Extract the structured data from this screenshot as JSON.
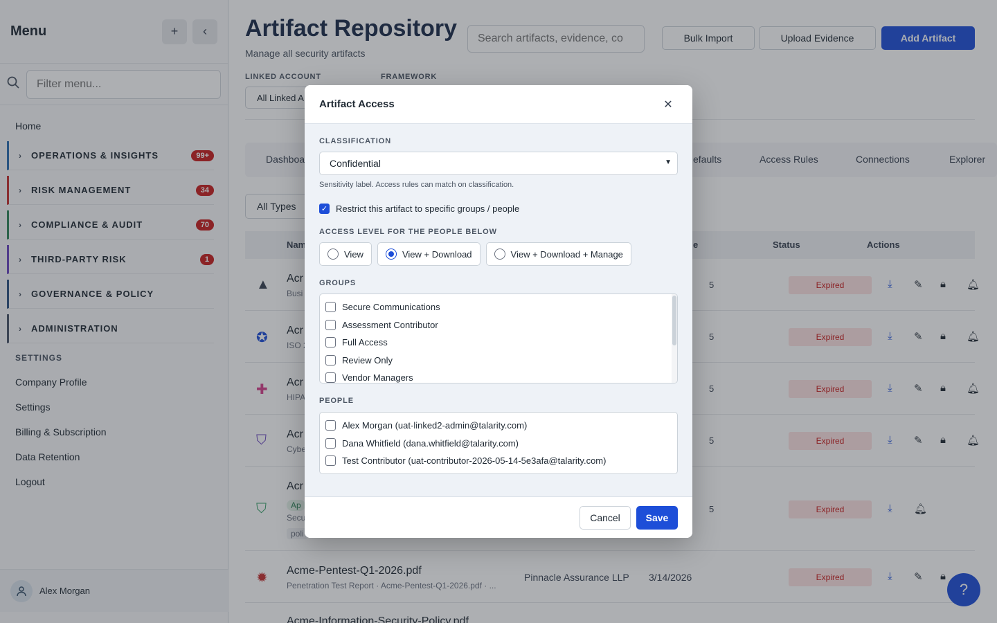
{
  "sidebar": {
    "title": "Menu",
    "add_icon": "plus-icon",
    "collapse_icon": "chevron-left-icon",
    "filter_placeholder": "Filter menu...",
    "home": "Home",
    "sections": [
      {
        "label": "OPERATIONS & INSIGHTS",
        "badge": "99+",
        "color": "#2b6cb0"
      },
      {
        "label": "RISK MANAGEMENT",
        "badge": "34",
        "color": "#c53030"
      },
      {
        "label": "COMPLIANCE & AUDIT",
        "badge": "70",
        "color": "#2f855a"
      },
      {
        "label": "THIRD-PARTY RISK",
        "badge": "1",
        "color": "#6b46c1"
      },
      {
        "label": "GOVERNANCE & POLICY",
        "badge": "",
        "color": "#2c5282"
      },
      {
        "label": "ADMINISTRATION",
        "badge": "",
        "color": "#4a5568"
      }
    ],
    "settings_title": "SETTINGS",
    "settings_links": [
      "Company Profile",
      "Settings",
      "Billing & Subscription",
      "Data Retention",
      "Logout"
    ],
    "user_name": "Alex Morgan"
  },
  "header": {
    "title": "Artifact Repository",
    "subtitle": "Manage all security artifacts",
    "search_placeholder": "Search artifacts, evidence, co",
    "bulk_import": "Bulk Import",
    "upload_evidence": "Upload Evidence",
    "add_artifact": "Add Artifact"
  },
  "filters": {
    "linked_account_label": "LINKED ACCOUNT",
    "linked_account_value": "All Linked A",
    "framework_label": "FRAMEWORK"
  },
  "tabs": [
    "Dashboa",
    "efaults",
    "Access Rules",
    "Connections",
    "Explorer"
  ],
  "types_filter": "All Types",
  "table": {
    "col_name": "Nam",
    "col_date": "e",
    "col_status": "Status",
    "col_actions": "Actions",
    "rows": [
      {
        "name": "Acr",
        "sub": "Busi",
        "date": "5",
        "status": "Expired"
      },
      {
        "name": "Acr",
        "sub": "ISO 2",
        "date": "5",
        "status": "Expired"
      },
      {
        "name": "Acr",
        "sub": "HIPA",
        "date": "5",
        "status": "Expired"
      },
      {
        "name": "Acr",
        "sub": "Cybe",
        "date": "5",
        "status": "Expired"
      },
      {
        "name": "Acr",
        "sub": "Secu",
        "tag_a": "Ap",
        "tag_b": "poli",
        "date": "5",
        "status": "Expired"
      },
      {
        "name": "Acme-Pentest-Q1-2026.pdf",
        "sub": "Penetration Test Report · Acme-Pentest-Q1-2026.pdf · ...",
        "vendor": "Pinnacle Assurance LLP",
        "date": "3/14/2026",
        "status": "Expired"
      },
      {
        "name": "Acme-Information-Security-Policy.pdf"
      }
    ]
  },
  "modal": {
    "title": "Artifact Access",
    "classification_label": "CLASSIFICATION",
    "classification_value": "Confidential",
    "classification_hint": "Sensitivity label. Access rules can match on classification.",
    "restrict_label": "Restrict this artifact to specific groups / people",
    "restrict_checked": true,
    "access_level_label": "ACCESS LEVEL FOR THE PEOPLE BELOW",
    "access_levels": [
      "View",
      "View + Download",
      "View + Download + Manage"
    ],
    "access_level_selected": "View + Download",
    "groups_label": "GROUPS",
    "groups": [
      "Secure Communications",
      "Assessment Contributor",
      "Full Access",
      "Review Only",
      "Vendor Managers"
    ],
    "people_label": "PEOPLE",
    "people": [
      "Alex Morgan (uat-linked2-admin@talarity.com)",
      "Dana Whitfield (dana.whitfield@talarity.com)",
      "Test Contributor (uat-contributor-2026-05-14-5e3afa@talarity.com)"
    ],
    "cancel": "Cancel",
    "save": "Save"
  },
  "colors": {
    "primary": "#1d4ed8",
    "badge": "#c81e1e",
    "expired_bg": "#fde2e2",
    "expired_text": "#c81e1e"
  }
}
